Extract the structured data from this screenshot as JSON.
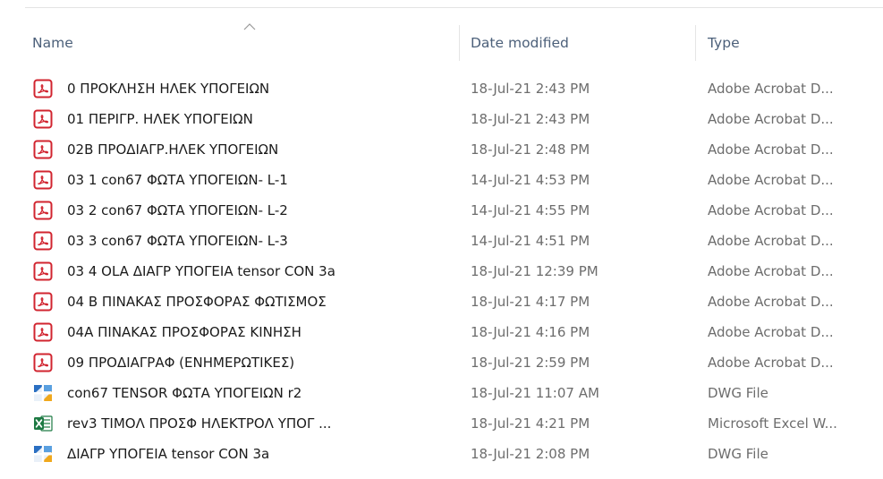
{
  "columns": {
    "name": "Name",
    "date_modified": "Date modified",
    "type": "Type"
  },
  "sort": {
    "column": "name",
    "direction": "ascending",
    "icon": "sort-up-chevron-icon"
  },
  "colors": {
    "header_text": "#4c607a",
    "pdf_red": "#d1242f",
    "dwg_blue": "#2a6fc2",
    "excel_green": "#1d7a43",
    "secondary_text": "#6d6d6d"
  },
  "files": [
    {
      "icon": "pdf-icon",
      "name": "0 ΠΡΟΚΛΗΣΗ ΗΛΕΚ ΥΠΟΓΕΙΩΝ",
      "date": "18-Jul-21 2:43 PM",
      "type": "Adobe Acrobat D..."
    },
    {
      "icon": "pdf-icon",
      "name": "01 ΠΕΡΙΓΡ. ΗΛΕΚ ΥΠΟΓΕΙΩΝ",
      "date": "18-Jul-21 2:43 PM",
      "type": "Adobe Acrobat D..."
    },
    {
      "icon": "pdf-icon",
      "name": "02Β ΠΡΟΔΙΑΓΡ.ΗΛΕΚ ΥΠΟΓΕΙΩΝ",
      "date": "18-Jul-21 2:48 PM",
      "type": "Adobe Acrobat D..."
    },
    {
      "icon": "pdf-icon",
      "name": "03 1 con67 ΦΩΤΑ ΥΠΟΓΕΙΩΝ- L-1",
      "date": "14-Jul-21 4:53 PM",
      "type": "Adobe Acrobat D..."
    },
    {
      "icon": "pdf-icon",
      "name": "03 2 con67 ΦΩΤΑ ΥΠΟΓΕΙΩΝ- L-2",
      "date": "14-Jul-21 4:55 PM",
      "type": "Adobe Acrobat D..."
    },
    {
      "icon": "pdf-icon",
      "name": "03 3 con67 ΦΩΤΑ ΥΠΟΓΕΙΩΝ- L-3",
      "date": "14-Jul-21 4:51 PM",
      "type": "Adobe Acrobat D..."
    },
    {
      "icon": "pdf-icon",
      "name": "03 4 OLA ΔΙΑΓΡ ΥΠΟΓΕΙΑ  tensor  CON 3a",
      "date": "18-Jul-21 12:39 PM",
      "type": "Adobe Acrobat D..."
    },
    {
      "icon": "pdf-icon",
      "name": "04 Β  ΠΙΝΑΚΑΣ ΠΡΟΣΦΟΡΑΣ ΦΩΤΙΣΜΟΣ",
      "date": "18-Jul-21 4:17 PM",
      "type": "Adobe Acrobat D..."
    },
    {
      "icon": "pdf-icon",
      "name": "04Α ΠΙΝΑΚΑΣ ΠΡΟΣΦΟΡΑΣ ΚΙΝΗΣΗ",
      "date": "18-Jul-21 4:16 PM",
      "type": "Adobe Acrobat D..."
    },
    {
      "icon": "pdf-icon",
      "name": "09 ΠΡΟΔΙΑΓΡΑΦ (ΕΝΗΜΕΡΩΤΙΚΕΣ)",
      "date": "18-Jul-21 2:59 PM",
      "type": "Adobe Acrobat D..."
    },
    {
      "icon": "dwg-icon",
      "name": "con67 TENSOR  ΦΩΤΑ ΥΠΟΓΕΙΩΝ r2",
      "date": "18-Jul-21 11:07 AM",
      "type": "DWG File"
    },
    {
      "icon": "excel-icon",
      "name": "rev3 ΤΙΜΟΛ ΠΡΟΣΦ  ΗΛΕΚΤΡΟΛ ΥΠΟΓ  ...",
      "date": "18-Jul-21 4:21 PM",
      "type": "Microsoft Excel W..."
    },
    {
      "icon": "dwg-icon",
      "name": "ΔΙΑΓΡ ΥΠΟΓΕΙΑ  tensor  CON 3a",
      "date": "18-Jul-21 2:08 PM",
      "type": "DWG File"
    }
  ]
}
